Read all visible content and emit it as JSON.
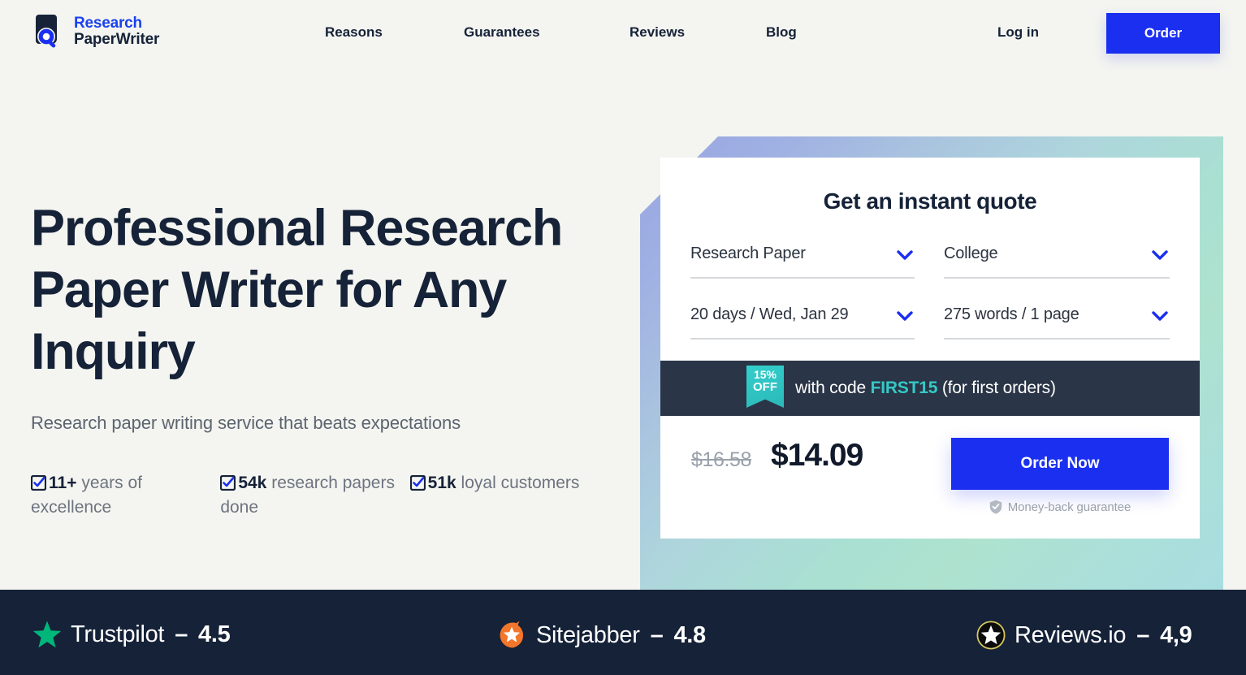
{
  "header": {
    "logo": {
      "icon": "document-magnifier-logo-icon",
      "line1": "Research",
      "line2": "PaperWriter",
      "line1_color": "#1a41f0",
      "line2_color": "#152238"
    },
    "nav": [
      {
        "label": "Reasons"
      },
      {
        "label": "Guarantees"
      },
      {
        "label": "Reviews"
      },
      {
        "label": "Blog"
      }
    ],
    "login_label": "Log in",
    "order_label": "Order",
    "order_color": "#1a2ff0"
  },
  "hero": {
    "title": "Professional Research Paper Writer for Any Inquiry",
    "subtitle": "Research paper writing service that beats expectations",
    "stats": [
      {
        "number": "11+",
        "label": "years of excellence"
      },
      {
        "number": "54k",
        "label": "research papers done"
      },
      {
        "number": "51k",
        "label": "loyal customers"
      }
    ]
  },
  "quote": {
    "title": "Get an instant quote",
    "selects": [
      {
        "name": "paper-type",
        "value": "Research Paper"
      },
      {
        "name": "academic-level",
        "value": "College"
      },
      {
        "name": "deadline",
        "value": "20 days / Wed, Jan 29"
      },
      {
        "name": "page-count",
        "value": "275 words / 1 page"
      }
    ],
    "promo": {
      "badge_top": "15%",
      "badge_bottom": "OFF",
      "text_before": "with code ",
      "code": "FIRST15",
      "text_after": " (for first orders)",
      "badge_color": "#33cfcc",
      "bar_color": "#2a3547"
    },
    "price_old": "$16.58",
    "price_new": "$14.09",
    "order_now_label": "Order Now",
    "guarantee_label": "Money-back guarantee"
  },
  "trustbar": {
    "background": "#152238",
    "items": [
      {
        "icon": "green-star-icon",
        "name": "Trustpilot",
        "dash": "–",
        "score": "4.5",
        "color": "#00b67a"
      },
      {
        "icon": "orange-speech-bubble-star-icon",
        "name": "Sitejabber",
        "dash": "–",
        "score": "4.8",
        "color": "#f4762a"
      },
      {
        "icon": "black-circle-star-icon",
        "name": "Reviews.io",
        "dash": "–",
        "score": "4,9",
        "color": "#0c0c0c"
      }
    ]
  }
}
